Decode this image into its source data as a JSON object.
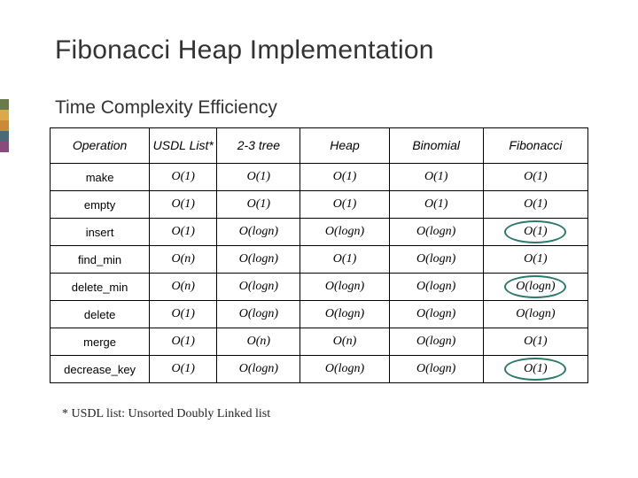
{
  "title": "Fibonacci Heap Implementation",
  "subtitle": "Time Complexity Efficiency",
  "footnote": "* USDL list: Unsorted Doubly Linked list",
  "headers": {
    "op": "Operation",
    "usdl": "USDL List*",
    "two3": "2-3 tree",
    "heap": "Heap",
    "binomial": "Binomial",
    "fibonacci": "Fibonacci"
  },
  "rows": [
    {
      "op": "make",
      "usdl": "O(1)",
      "two3": "O(1)",
      "heap": "O(1)",
      "binomial": "O(1)",
      "fibonacci": "O(1)",
      "hl": false
    },
    {
      "op": "empty",
      "usdl": "O(1)",
      "two3": "O(1)",
      "heap": "O(1)",
      "binomial": "O(1)",
      "fibonacci": "O(1)",
      "hl": false
    },
    {
      "op": "insert",
      "usdl": "O(1)",
      "two3": "O(logn)",
      "heap": "O(logn)",
      "binomial": "O(logn)",
      "fibonacci": "O(1)",
      "hl": true
    },
    {
      "op": "find_min",
      "usdl": "O(n)",
      "two3": "O(logn)",
      "heap": "O(1)",
      "binomial": "O(logn)",
      "fibonacci": "O(1)",
      "hl": false
    },
    {
      "op": "delete_min",
      "usdl": "O(n)",
      "two3": "O(logn)",
      "heap": "O(logn)",
      "binomial": "O(logn)",
      "fibonacci": "O(logn)",
      "hl": true
    },
    {
      "op": "delete",
      "usdl": "O(1)",
      "two3": "O(logn)",
      "heap": "O(logn)",
      "binomial": "O(logn)",
      "fibonacci": "O(logn)",
      "hl": false
    },
    {
      "op": "merge",
      "usdl": "O(1)",
      "two3": "O(n)",
      "heap": "O(n)",
      "binomial": "O(logn)",
      "fibonacci": "O(1)",
      "hl": false
    },
    {
      "op": "decrease_key",
      "usdl": "O(1)",
      "two3": "O(logn)",
      "heap": "O(logn)",
      "binomial": "O(logn)",
      "fibonacci": "O(1)",
      "hl": true
    }
  ],
  "chart_data": {
    "type": "table",
    "title": "Time Complexity Efficiency",
    "columns": [
      "Operation",
      "USDL List*",
      "2-3 tree",
      "Heap",
      "Binomial",
      "Fibonacci"
    ],
    "data": [
      [
        "make",
        "O(1)",
        "O(1)",
        "O(1)",
        "O(1)",
        "O(1)"
      ],
      [
        "empty",
        "O(1)",
        "O(1)",
        "O(1)",
        "O(1)",
        "O(1)"
      ],
      [
        "insert",
        "O(1)",
        "O(logn)",
        "O(logn)",
        "O(logn)",
        "O(1)"
      ],
      [
        "find_min",
        "O(n)",
        "O(logn)",
        "O(1)",
        "O(logn)",
        "O(1)"
      ],
      [
        "delete_min",
        "O(n)",
        "O(logn)",
        "O(logn)",
        "O(logn)",
        "O(logn)"
      ],
      [
        "delete",
        "O(1)",
        "O(logn)",
        "O(logn)",
        "O(logn)",
        "O(logn)"
      ],
      [
        "merge",
        "O(1)",
        "O(n)",
        "O(n)",
        "O(logn)",
        "O(1)"
      ],
      [
        "decrease_key",
        "O(1)",
        "O(logn)",
        "O(logn)",
        "O(logn)",
        "O(1)"
      ]
    ],
    "highlighted_cells": [
      {
        "row": "insert",
        "col": "Fibonacci"
      },
      {
        "row": "delete_min",
        "col": "Fibonacci"
      },
      {
        "row": "decrease_key",
        "col": "Fibonacci"
      }
    ]
  }
}
